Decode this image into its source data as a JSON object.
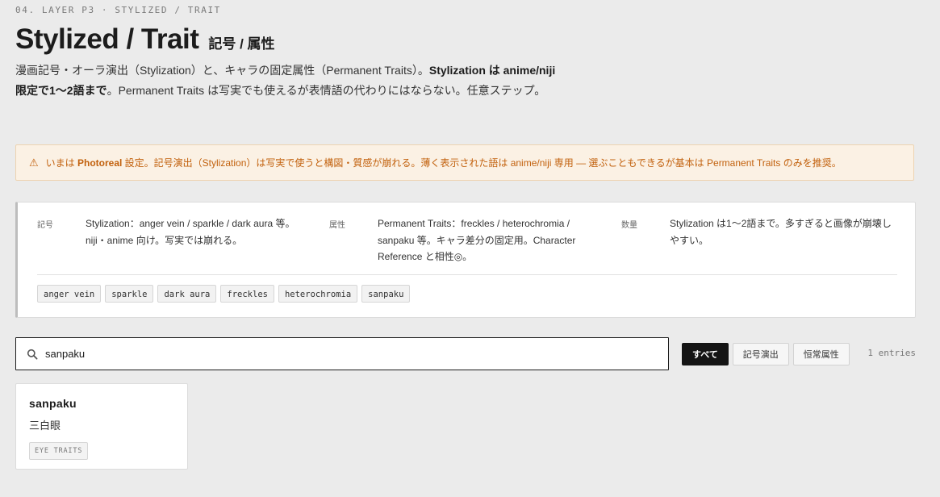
{
  "header": {
    "eyebrow": "04. LAYER P3 · STYLIZED / TRAIT",
    "title": "Stylized / Trait",
    "subtitle": "記号 / 属性",
    "description": {
      "part1": "漫画記号・オーラ演出（Stylization）と、キャラの固定属性（Permanent Traits）。",
      "bold": "Stylization は anime/niji 限定で1〜2語まで",
      "part2": "。Permanent Traits は写実でも使えるが表情語の代わりにはならない。任意ステップ。"
    }
  },
  "warning": {
    "icon": "warning-triangle-icon",
    "prefix": "いまは ",
    "mode": "Photoreal",
    "text": " 設定。記号演出（Stylization）は写実で使うと構図・質感が崩れる。薄く表示された語は anime/niji 専用 — 選ぶこともできるが基本は Permanent Traits のみを推奨。"
  },
  "info": {
    "items": [
      {
        "key": "記号",
        "value": "Stylization：anger vein / sparkle / dark aura 等。niji・anime 向け。写実では崩れる。"
      },
      {
        "key": "属性",
        "value": "Permanent Traits：freckles / heterochromia / sanpaku 等。キャラ差分の固定用。Character Reference と相性◎。"
      },
      {
        "key": "数量",
        "value": "Stylization は1〜2語まで。多すぎると画像が崩壊しやすい。"
      }
    ],
    "chips": [
      "anger vein",
      "sparkle",
      "dark aura",
      "freckles",
      "heterochromia",
      "sanpaku"
    ]
  },
  "search": {
    "value": "sanpaku",
    "icon": "search-icon"
  },
  "filters": {
    "all": "すべて",
    "stylization": "記号演出",
    "traits": "恒常属性",
    "active": "all"
  },
  "entries_count": "1 entries",
  "results": [
    {
      "term": "sanpaku",
      "jp": "三白眼",
      "tag": "EYE TRAITS"
    }
  ],
  "colors": {
    "background": "#ebebeb",
    "warning_text": "#c2610d",
    "warning_bg": "#fbf1e4",
    "active_filter": "#141414"
  }
}
